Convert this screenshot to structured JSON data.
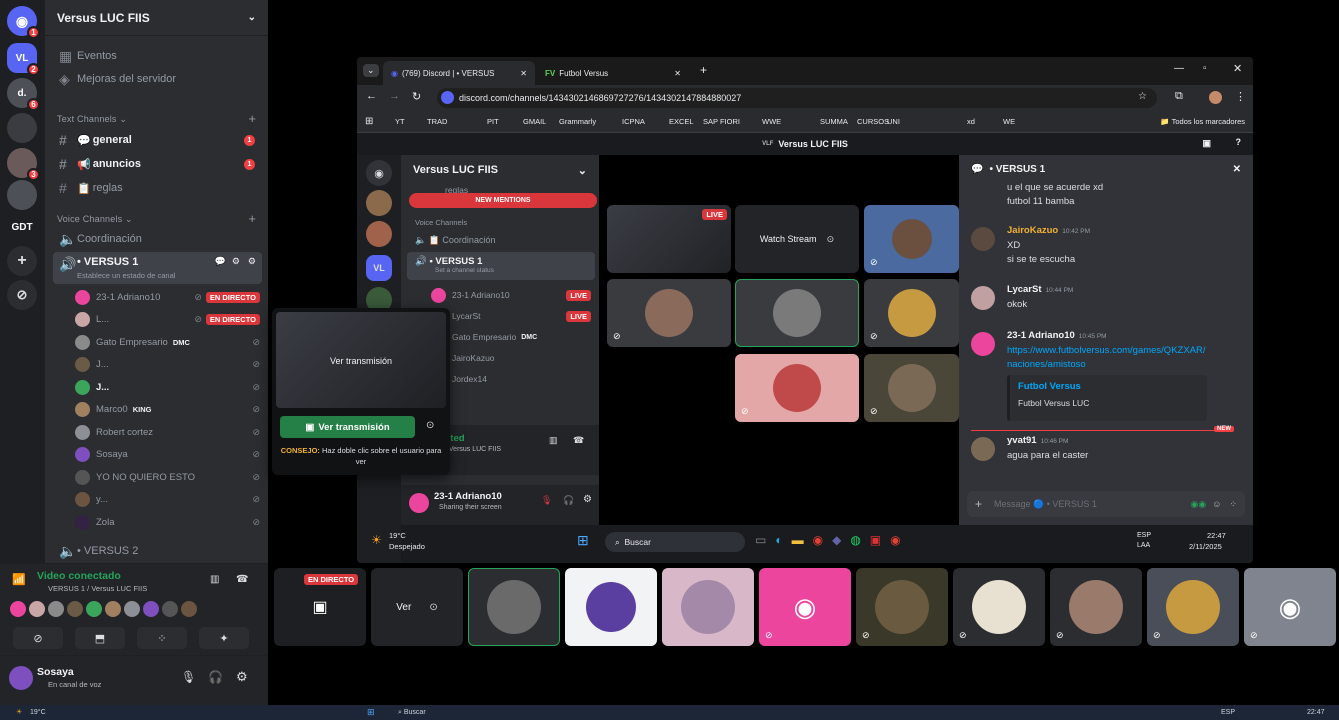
{
  "server": {
    "name": "Versus LUC FIIS"
  },
  "rail": {
    "servers": [
      {
        "label": "VL",
        "color": "#5865f2",
        "badge": "2"
      },
      {
        "label": "d.",
        "color": "#4e5058",
        "badge": "6"
      },
      {
        "label": "",
        "color": "#3a3c42",
        "badge": ""
      },
      {
        "label": "",
        "color": "#6a5a5a",
        "badge": "3"
      },
      {
        "label": "",
        "color": "#4e5058",
        "badge": ""
      },
      {
        "label": "GDT",
        "color": "#1e1f22",
        "badge": ""
      }
    ],
    "home_badge": "1"
  },
  "sidebar": {
    "events": "Eventos",
    "boosts": "Mejoras del servidor",
    "text_category": "Text Channels",
    "text_channels": [
      {
        "name": "general",
        "badge": "1",
        "bold": true
      },
      {
        "name": "anuncios",
        "badge": "1",
        "bold": true
      },
      {
        "name": "reglas",
        "badge": "",
        "bold": false
      }
    ],
    "voice_category": "Voice Channels",
    "voice_channels": [
      {
        "name": "Coordinación"
      },
      {
        "name": "• VERSUS 1",
        "status": "Establece un estado de canal"
      },
      {
        "name": "• VERSUS 2"
      }
    ],
    "voice_users": [
      {
        "name": "23-1 Adriano10",
        "live": "EN DIRECTO",
        "tag": "",
        "av": "#eb459e"
      },
      {
        "name": "L...",
        "live": "EN DIRECTO",
        "tag": "",
        "av": "#c9a6a6"
      },
      {
        "name": "Gato Empresario",
        "live": "",
        "tag": "DMC",
        "av": "#8a8a8a"
      },
      {
        "name": "J...",
        "live": "",
        "tag": "",
        "av": "#6b5a45"
      },
      {
        "name": "J...",
        "live": "",
        "tag": "",
        "av": "#3ba55c",
        "bright": true
      },
      {
        "name": "Marco0",
        "live": "",
        "tag": "KING",
        "av": "#a08060"
      },
      {
        "name": "Robert cortez",
        "live": "",
        "tag": "",
        "av": "#8c8f96"
      },
      {
        "name": "Sosaya",
        "live": "",
        "tag": "",
        "av": "#7d4fbf"
      },
      {
        "name": "YO NO QUIERO ESTO",
        "live": "",
        "tag": "",
        "av": "#555"
      },
      {
        "name": "y...",
        "live": "",
        "tag": "",
        "av": "#6b5440"
      },
      {
        "name": "Zola",
        "live": "",
        "tag": "",
        "av": "#332244"
      }
    ]
  },
  "voice_panel": {
    "status": "Video conectado",
    "channel": "VERSUS 1 / Versus LUC FIIS"
  },
  "user_panel": {
    "name": "Sosaya",
    "status": "En canal de voz"
  },
  "popup": {
    "caption": "Ver transmisión",
    "button": "Ver transmisión",
    "tip_label": "CONSEJO:",
    "tip": "Haz doble clic sobre el usuario para ver"
  },
  "browser": {
    "tabs": [
      {
        "title": "(769) Discord | • VERSUS",
        "active": true
      },
      {
        "title": "Futbol Versus",
        "active": false
      }
    ],
    "url": "discord.com/channels/1434302146869727276/1434302147884880027",
    "bookmarks": [
      "YT",
      "TRAD",
      "PIT",
      "GMAIL",
      "Grammarly",
      "ICPNA",
      "EXCEL",
      "SAP FIORI",
      "WWE",
      "SUMMA",
      "CURSOS",
      "UNI",
      "xd",
      "WE"
    ],
    "all_bookmarks": "Todos los marcadores"
  },
  "inner": {
    "top_title": "Versus LUC FIIS",
    "top_badge": "VLF",
    "server_name": "Versus LUC FIIS",
    "reglas": "reglas",
    "new_mentions": "NEW MENTIONS",
    "voice_category": "Voice Channels",
    "coordinacion": "Coordinación",
    "versus1": "• VERSUS 1",
    "status_hint": "Set a channel status",
    "users": [
      {
        "name": "23-1 Adriano10",
        "live": "LIVE"
      },
      {
        "name": "LycarSt",
        "live": "LIVE"
      },
      {
        "name": "Gato Empresario",
        "tag": "DMC"
      },
      {
        "name": "JairoKazuo"
      },
      {
        "name": "Jordex14"
      }
    ],
    "connected": "cted",
    "connected_sub": "/ Versus LUC FIIS",
    "self_name": "23-1 Adriano10",
    "self_status": "Sharing their screen",
    "watch_stream": "Watch Stream",
    "live": "LIVE",
    "chat": {
      "header": "• VERSUS 1",
      "messages": [
        {
          "name": "",
          "time": "",
          "lines": [
            "u el que se acuerde xd",
            "futbol 11 bamba"
          ]
        },
        {
          "name": "JairoKazuo",
          "time": "10:42 PM",
          "color": "#f0b232",
          "lines": [
            "XD",
            "si se te escucha"
          ]
        },
        {
          "name": "LycarSt",
          "time": "10:44 PM",
          "color": "#f2f3f5",
          "lines": [
            "okok"
          ]
        },
        {
          "name": "23-1 Adriano10",
          "time": "10:45 PM",
          "color": "#f2f3f5",
          "lines": [
            "https://www.futbolversus.com/games/QKZXAR/",
            "naciones/amistoso"
          ]
        },
        {
          "name": "yvat91",
          "time": "10:46 PM",
          "color": "#f2f3f5",
          "lines": [
            "agua para el caster"
          ]
        }
      ],
      "embed_title": "Futbol Versus",
      "embed_desc": "Futbol Versus LUC",
      "new_label": "NEW",
      "placeholder": "Message 🔵 • VERSUS 1"
    },
    "taskbar": {
      "temp": "19°C",
      "weather": "Despejado",
      "search": "Buscar",
      "lang": "ESP",
      "lang2": "LAA",
      "time": "22:47",
      "date": "2/11/2025"
    }
  },
  "strip": {
    "en_directo": "EN DIRECTO",
    "ver": "Ver"
  },
  "taskbar": {
    "temp": "19°C",
    "search": "Buscar",
    "lang": "ESP",
    "time": "22:47"
  }
}
